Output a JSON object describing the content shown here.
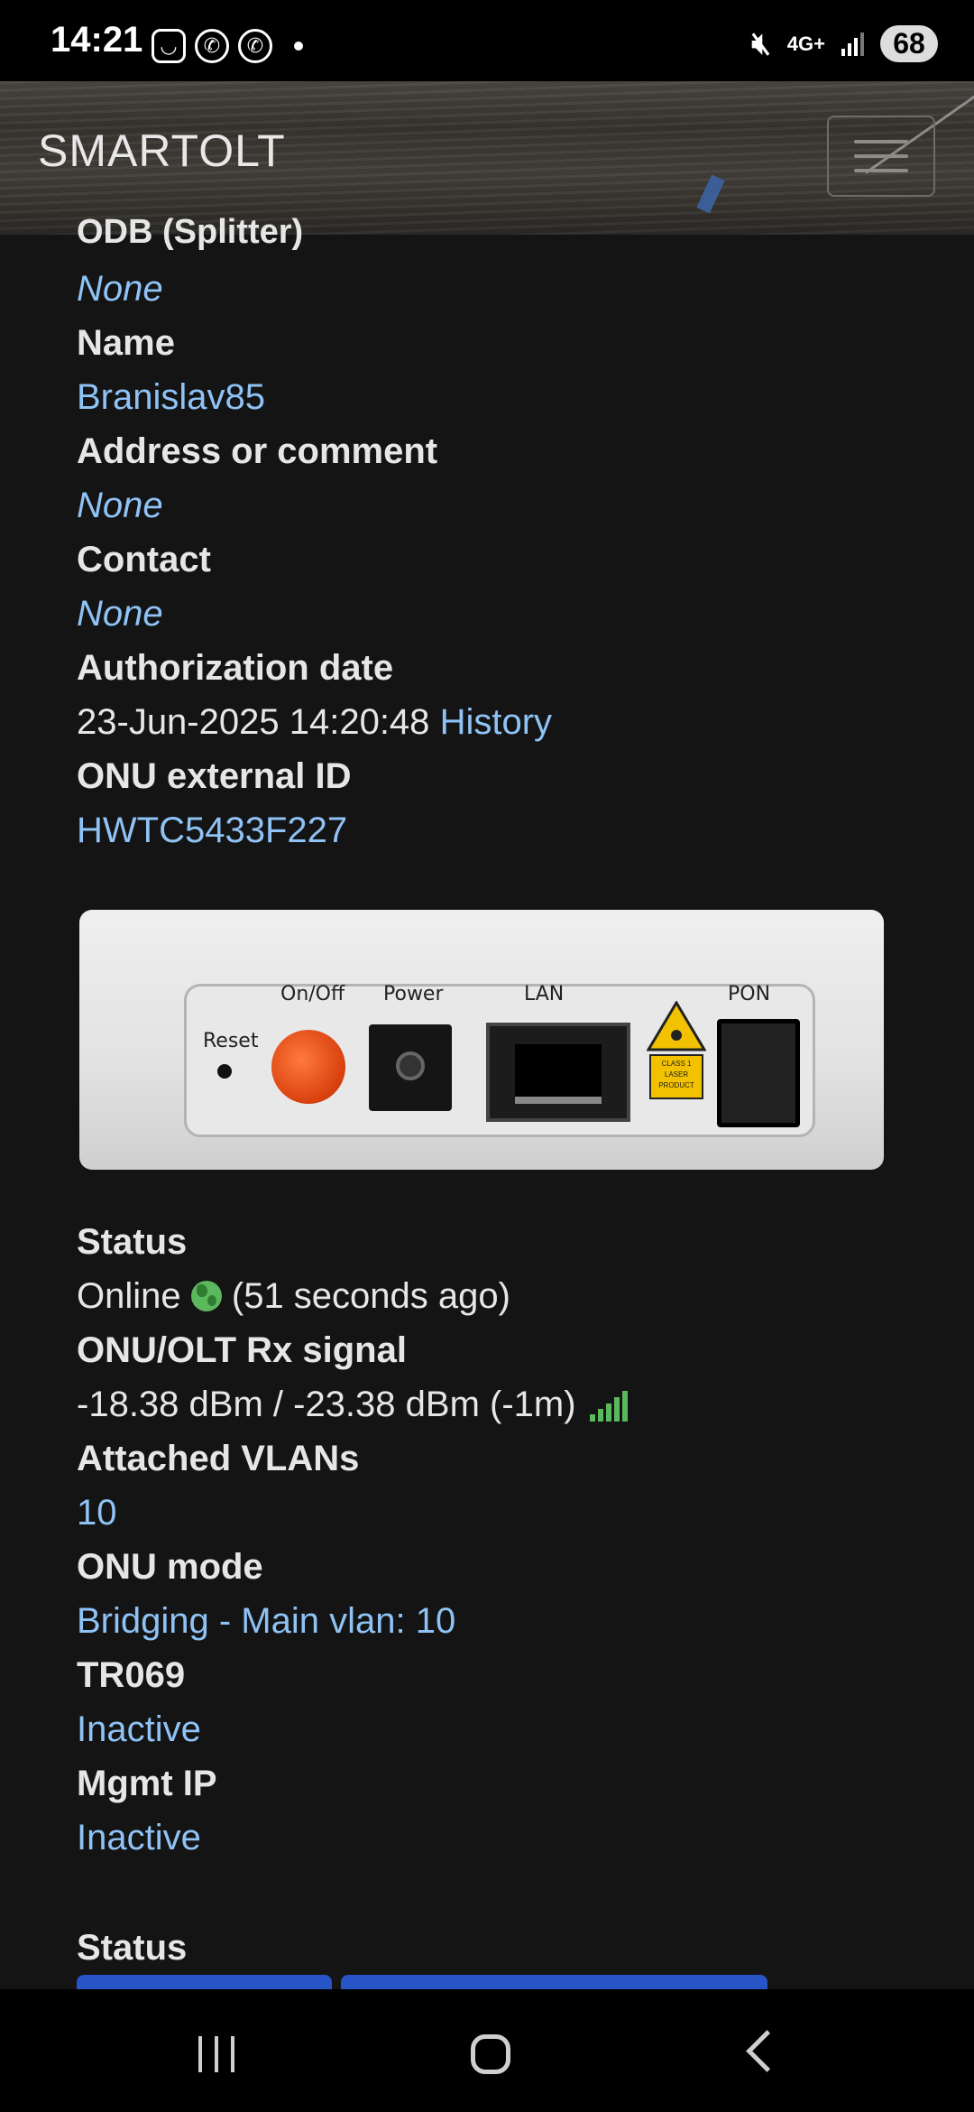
{
  "status_bar": {
    "time": "14:21",
    "network": "4G+",
    "battery": "68",
    "icons": [
      "notification-app-icon",
      "viber-icon",
      "viber-icon",
      "mute-icon",
      "signal-icon"
    ]
  },
  "navbar": {
    "brand": "SMARTOLT",
    "menu_icon": "hamburger-menu-icon"
  },
  "details": {
    "odb_label": "ODB (Splitter)",
    "odb_value": "None",
    "name_label": "Name",
    "name_value": "Branislav85",
    "address_label": "Address or comment",
    "address_value": "None",
    "contact_label": "Contact",
    "contact_value": "None",
    "auth_label": "Authorization date",
    "auth_value": "23-Jun-2025 14:20:48",
    "auth_link": "History",
    "ext_id_label": "ONU external ID",
    "ext_id_value": "HWTC5433F227"
  },
  "device_image": {
    "reset": "Reset",
    "onoff": "On/Off",
    "power": "Power",
    "lan": "LAN",
    "pon": "PON",
    "laser": "CLASS 1 LASER PRODUCT"
  },
  "status": {
    "status_label": "Status",
    "status_online": "Online",
    "status_ago": "(51 seconds ago)",
    "signal_label": "ONU/OLT Rx signal",
    "signal_value": "-18.38 dBm / -23.38 dBm (-1m)",
    "vlans_label": "Attached VLANs",
    "vlans_value": "10",
    "mode_label": "ONU mode",
    "mode_value": "Bridging - Main vlan: 10",
    "tr069_label": "TR069",
    "tr069_value": "Inactive",
    "mgmt_label": "Mgmt IP",
    "mgmt_value": "Inactive",
    "section_label": "Status"
  },
  "colors": {
    "link": "#8fc2f5",
    "online_green": "#5cb85c",
    "button_blue": "#2754c6"
  }
}
